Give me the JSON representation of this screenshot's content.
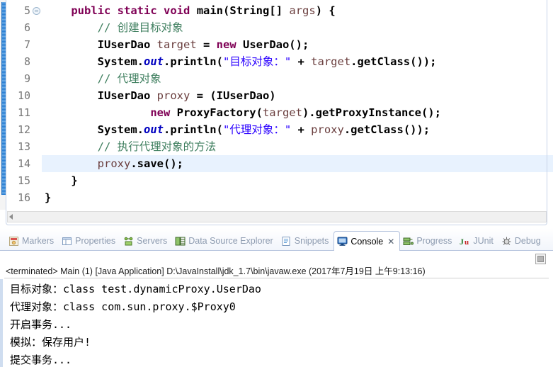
{
  "editor": {
    "first_line": 5,
    "current_line": 14,
    "fold_icon": "collapse-icon",
    "lines": [
      {
        "number": "5",
        "folded": true,
        "current": false,
        "tokens": [
          {
            "t": "    ",
            "c": "plain"
          },
          {
            "t": "public",
            "c": "kw"
          },
          {
            "t": " ",
            "c": "plain"
          },
          {
            "t": "static",
            "c": "kw"
          },
          {
            "t": " ",
            "c": "plain"
          },
          {
            "t": "void",
            "c": "kw"
          },
          {
            "t": " ",
            "c": "plain"
          },
          {
            "t": "main",
            "c": "type"
          },
          {
            "t": "(",
            "c": "type"
          },
          {
            "t": "String",
            "c": "type"
          },
          {
            "t": "[] ",
            "c": "type"
          },
          {
            "t": "args",
            "c": "localv"
          },
          {
            "t": ") {",
            "c": "type"
          }
        ]
      },
      {
        "number": "6",
        "folded": false,
        "current": false,
        "tokens": [
          {
            "t": "        ",
            "c": "plain"
          },
          {
            "t": "// 创建目标对象",
            "c": "cmt"
          }
        ]
      },
      {
        "number": "7",
        "folded": false,
        "current": false,
        "tokens": [
          {
            "t": "        ",
            "c": "plain"
          },
          {
            "t": "IUserDao ",
            "c": "type"
          },
          {
            "t": "target",
            "c": "localv"
          },
          {
            "t": " = ",
            "c": "type"
          },
          {
            "t": "new",
            "c": "kw"
          },
          {
            "t": " UserDao();",
            "c": "type"
          }
        ]
      },
      {
        "number": "8",
        "folded": false,
        "current": false,
        "tokens": [
          {
            "t": "        ",
            "c": "plain"
          },
          {
            "t": "System.",
            "c": "type"
          },
          {
            "t": "out",
            "c": "field-s"
          },
          {
            "t": ".println(",
            "c": "type"
          },
          {
            "t": "\"目标对象：\"",
            "c": "str"
          },
          {
            "t": " + ",
            "c": "type"
          },
          {
            "t": "target",
            "c": "localv"
          },
          {
            "t": ".getClass());",
            "c": "type"
          }
        ]
      },
      {
        "number": "9",
        "folded": false,
        "current": false,
        "tokens": [
          {
            "t": "        ",
            "c": "plain"
          },
          {
            "t": "// 代理对象",
            "c": "cmt"
          }
        ]
      },
      {
        "number": "10",
        "folded": false,
        "current": false,
        "tokens": [
          {
            "t": "        ",
            "c": "plain"
          },
          {
            "t": "IUserDao ",
            "c": "type"
          },
          {
            "t": "proxy",
            "c": "localv"
          },
          {
            "t": " = (IUserDao)",
            "c": "type"
          }
        ]
      },
      {
        "number": "11",
        "folded": false,
        "current": false,
        "tokens": [
          {
            "t": "                ",
            "c": "plain"
          },
          {
            "t": "new",
            "c": "kw"
          },
          {
            "t": " ProxyFactory(",
            "c": "type"
          },
          {
            "t": "target",
            "c": "localv"
          },
          {
            "t": ").getProxyInstance();",
            "c": "type"
          }
        ]
      },
      {
        "number": "12",
        "folded": false,
        "current": false,
        "tokens": [
          {
            "t": "        ",
            "c": "plain"
          },
          {
            "t": "System.",
            "c": "type"
          },
          {
            "t": "out",
            "c": "field-s"
          },
          {
            "t": ".println(",
            "c": "type"
          },
          {
            "t": "\"代理对象：\"",
            "c": "str"
          },
          {
            "t": " + ",
            "c": "type"
          },
          {
            "t": "proxy",
            "c": "localv"
          },
          {
            "t": ".getClass());",
            "c": "type"
          }
        ]
      },
      {
        "number": "13",
        "folded": false,
        "current": false,
        "tokens": [
          {
            "t": "        ",
            "c": "plain"
          },
          {
            "t": "// 执行代理对象的方法",
            "c": "cmt"
          }
        ]
      },
      {
        "number": "14",
        "folded": false,
        "current": true,
        "tokens": [
          {
            "t": "        ",
            "c": "plain"
          },
          {
            "t": "proxy",
            "c": "localv"
          },
          {
            "t": ".save();",
            "c": "type"
          }
        ]
      },
      {
        "number": "15",
        "folded": false,
        "current": false,
        "tokens": [
          {
            "t": "    }",
            "c": "type"
          }
        ]
      },
      {
        "number": "16",
        "folded": false,
        "current": false,
        "tokens": [
          {
            "t": "}",
            "c": "type"
          }
        ]
      }
    ]
  },
  "view_tabs": [
    {
      "label": "Markers",
      "icon": "markers-icon",
      "active": false,
      "closable": false
    },
    {
      "label": "Properties",
      "icon": "properties-icon",
      "active": false,
      "closable": false
    },
    {
      "label": "Servers",
      "icon": "servers-icon",
      "active": false,
      "closable": false
    },
    {
      "label": "Data Source Explorer",
      "icon": "data-source-explorer-icon",
      "active": false,
      "closable": false
    },
    {
      "label": "Snippets",
      "icon": "snippets-icon",
      "active": false,
      "closable": false
    },
    {
      "label": "Console",
      "icon": "console-icon",
      "active": true,
      "closable": true,
      "close_glyph": "✕"
    },
    {
      "label": "Progress",
      "icon": "progress-icon",
      "active": false,
      "closable": false
    },
    {
      "label": "JUnit",
      "icon": "junit-icon",
      "active": false,
      "closable": false
    },
    {
      "label": "Debug",
      "icon": "debug-icon",
      "active": false,
      "closable": false
    }
  ],
  "console": {
    "header": "<terminated> Main (1) [Java Application] D:\\JavaInstall\\jdk_1.7\\bin\\javaw.exe (2017年7月19日 上午9:13:16)",
    "toolbar_button": "terminate-button",
    "output": [
      "目标对象：class test.dynamicProxy.UserDao",
      "代理对象：class com.sun.proxy.$Proxy0",
      "开启事务...",
      "模拟：保存用户!",
      "提交事务..."
    ]
  },
  "colors": {
    "keyword": "#7F0055",
    "comment": "#3F7F5F",
    "string": "#2A00FF",
    "static_field": "#0000C0",
    "local_var": "#6A3E3E",
    "current_line_bg": "#E8F2FE",
    "annotation_bar": "#2A7FD4"
  }
}
